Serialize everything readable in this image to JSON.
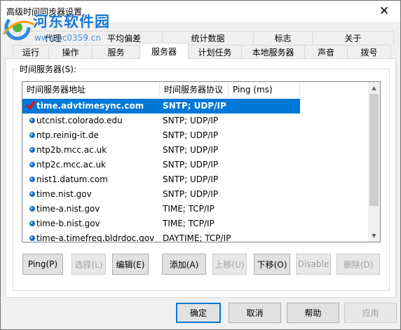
{
  "window": {
    "title": "高级时间同步器设置",
    "close_glyph": "✕"
  },
  "watermark": {
    "name": "河东软件园",
    "url": "www.pc0359.cn"
  },
  "tabs_back": [
    "代理",
    "平均偏差",
    "统计数据",
    "标志",
    "关于"
  ],
  "tabs_front": [
    "运行",
    "操作",
    "服务",
    "服务器",
    "计划任务",
    "本地服务器",
    "声音",
    "拨号"
  ],
  "group": {
    "label": "时间服务器(S):"
  },
  "list": {
    "columns": [
      "时间服务器地址",
      "时间服务器协议",
      "Ping (ms)"
    ],
    "rows": [
      {
        "address": "time.advtimesync.com",
        "protocol": "SNTP; UDP/IP",
        "selected": true,
        "icon": "checkmark-icon"
      },
      {
        "address": "utcnist.colorado.edu",
        "protocol": "SNTP; UDP/IP",
        "icon": "server-dot-icon"
      },
      {
        "address": "ntp.reinig-it.de",
        "protocol": "SNTP; UDP/IP",
        "icon": "server-dot-icon"
      },
      {
        "address": "ntp2b.mcc.ac.uk",
        "protocol": "SNTP; UDP/IP",
        "icon": "server-dot-icon"
      },
      {
        "address": "ntp2c.mcc.ac.uk",
        "protocol": "SNTP; UDP/IP",
        "icon": "server-dot-icon"
      },
      {
        "address": "nist1.datum.com",
        "protocol": "SNTP; UDP/IP",
        "icon": "server-dot-icon"
      },
      {
        "address": "time.nist.gov",
        "protocol": "SNTP; UDP/IP",
        "icon": "server-dot-icon"
      },
      {
        "address": "time-a.nist.gov",
        "protocol": "TIME; TCP/IP",
        "icon": "server-dot-icon"
      },
      {
        "address": "time-b.nist.gov",
        "protocol": "TIME; TCP/IP",
        "icon": "server-dot-icon"
      },
      {
        "address": "time-a.timefreq.bldrdoc.gov",
        "protocol": "DAYTIME; TCP/IP",
        "icon": "server-dot-icon"
      }
    ]
  },
  "list_buttons": {
    "ping": "Ping(P)",
    "select": "选择(L)",
    "edit": "编辑(E)",
    "add": "添加(A)",
    "move_up": "上移(U)",
    "move_down": "下移(O)",
    "disable": "Disable",
    "delete": "删除(D)"
  },
  "dialog_buttons": {
    "ok": "确定",
    "cancel": "取消",
    "help": "帮助",
    "apply": "应用"
  },
  "colors": {
    "selection": "#0078d7",
    "watermark": "#1a79d1",
    "icon_blue": "#1c70c0",
    "check_red": "#e0101e"
  }
}
